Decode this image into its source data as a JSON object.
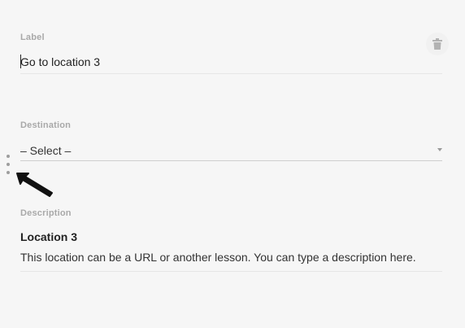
{
  "label_field": {
    "label": "Label",
    "value": "Go to location 3"
  },
  "destination_field": {
    "label": "Destination",
    "selected": "– Select –"
  },
  "description_field": {
    "label": "Description",
    "title": "Location 3",
    "text": "This location can be a URL or another lesson. You can type a description here."
  },
  "icons": {
    "delete": "trash-icon",
    "drag": "drag-handle-icon",
    "dropdown": "caret-down-icon",
    "cursor": "mouse-pointer-arrow"
  },
  "colors": {
    "background": "#f6f6f6",
    "label_gray": "#a9a9a9",
    "text": "#222222"
  }
}
